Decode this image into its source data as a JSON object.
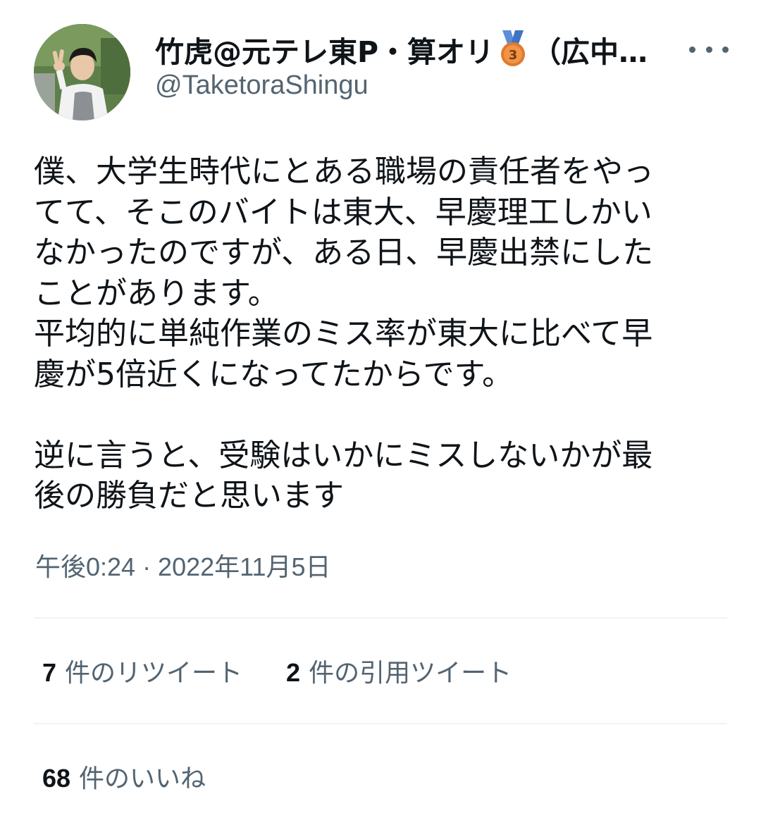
{
  "author": {
    "display_name": "竹虎@元テレ東P・算オリ",
    "display_name_suffix": "（広中…",
    "handle": "@TaketoraShingu",
    "badge_icon": "bronze-medal-3-icon",
    "badge_number": "3"
  },
  "tweet": {
    "lines": [
      "僕、大学生時代にとある職場の責任者をやっ",
      "てて、そこのバイトは東大、早慶理工しかい",
      "なかったのですが、ある日、早慶出禁にした",
      "ことがあります。",
      "平均的に単純作業のミス率が東大に比べて早",
      "慶が5倍近くになってたからです。",
      "",
      "逆に言うと、受験はいかにミスしないかが最",
      "後の勝負だと思います"
    ],
    "timestamp": "午後0:24 · 2022年11月5日"
  },
  "stats": {
    "retweets": {
      "count": "7",
      "label": "件のリツイート"
    },
    "quotes": {
      "count": "2",
      "label": "件の引用ツイート"
    },
    "likes": {
      "count": "68",
      "label": "件のいいね"
    }
  },
  "colors": {
    "text": "#0f1419",
    "secondary": "#536471",
    "divider": "#eff3f4",
    "medal": "#e07a2c",
    "ribbon": "#5b8ed6"
  }
}
